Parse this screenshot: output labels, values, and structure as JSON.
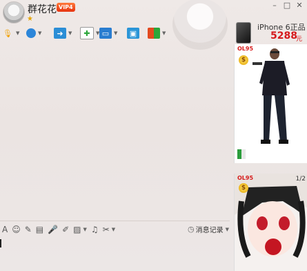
{
  "window": {
    "contact_name": "群花花",
    "vip_badge": "VIP4",
    "star": "★",
    "buttons": {
      "minimize": "–",
      "maximize": "□",
      "close": "✕"
    }
  },
  "toolbar": {
    "icons": [
      {
        "name": "mic-icon",
        "glyph": "🎙",
        "color": "#f2a100"
      },
      {
        "name": "camera-icon",
        "glyph": "●",
        "color": "#2c86d9"
      },
      {
        "name": "folder-icon",
        "glyph": "➜",
        "color": "#2b8ed6"
      },
      {
        "name": "chat-add-icon",
        "glyph": "✚",
        "color": "#2ba63b"
      },
      {
        "name": "monitor-icon",
        "glyph": "▭",
        "color": "#2a7dd0"
      },
      {
        "name": "share-screen-icon",
        "glyph": "▣",
        "color": "#2a95d7"
      },
      {
        "name": "apps-icon",
        "glyph": "▦",
        "color": "#e34a1f"
      }
    ]
  },
  "ad": {
    "product": "iPhone 6正品",
    "price": "5288",
    "unit": "元",
    "page": "1/2",
    "brand_mark": "OL95",
    "coin": "$"
  },
  "bottom_toolbar": {
    "icons": [
      "font-icon",
      "emoji-icon",
      "magic-icon",
      "video-icon",
      "voice-icon",
      "edit-icon",
      "image-icon",
      "music-icon",
      "scissors-icon"
    ],
    "glyphs": [
      "A",
      "☺",
      "✎",
      "▤",
      "🎤",
      "✐",
      "▨",
      "♫",
      "✂"
    ],
    "history_label": "消息记录"
  }
}
